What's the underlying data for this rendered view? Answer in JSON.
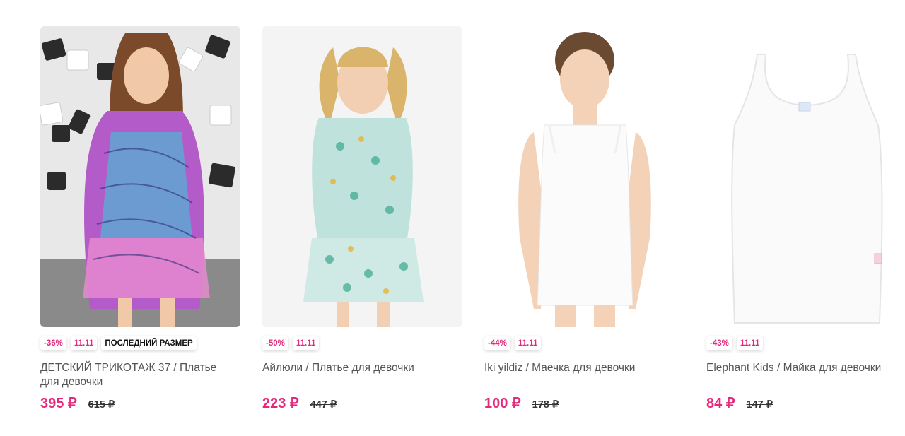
{
  "colors": {
    "accent": "#e5287c",
    "text": "#555555",
    "old_price": "#333333"
  },
  "products": [
    {
      "image": "girl-in-colorful-zebra-print-dress",
      "badges": [
        "-36%",
        "11.11",
        "ПОСЛЕДНИЙ РАЗМЕР"
      ],
      "title": "ДЕТСКИЙ ТРИКОТАЖ 37 / Платье для девочки",
      "price": "395 ₽",
      "old_price": "615 ₽"
    },
    {
      "image": "girl-in-floral-mint-dress",
      "badges": [
        "-50%",
        "11.11"
      ],
      "title": "Айлюли / Платье для девочки",
      "price": "223 ₽",
      "old_price": "447 ₽"
    },
    {
      "image": "girl-in-white-tank-top",
      "badges": [
        "-44%",
        "11.11"
      ],
      "title": "Iki yildiz / Маечка для девочки",
      "price": "100 ₽",
      "old_price": "178 ₽"
    },
    {
      "image": "white-tank-top",
      "badges": [
        "-43%",
        "11.11"
      ],
      "title": "Elephant Kids / Майка для девочки",
      "price": "84 ₽",
      "old_price": "147 ₽"
    }
  ]
}
